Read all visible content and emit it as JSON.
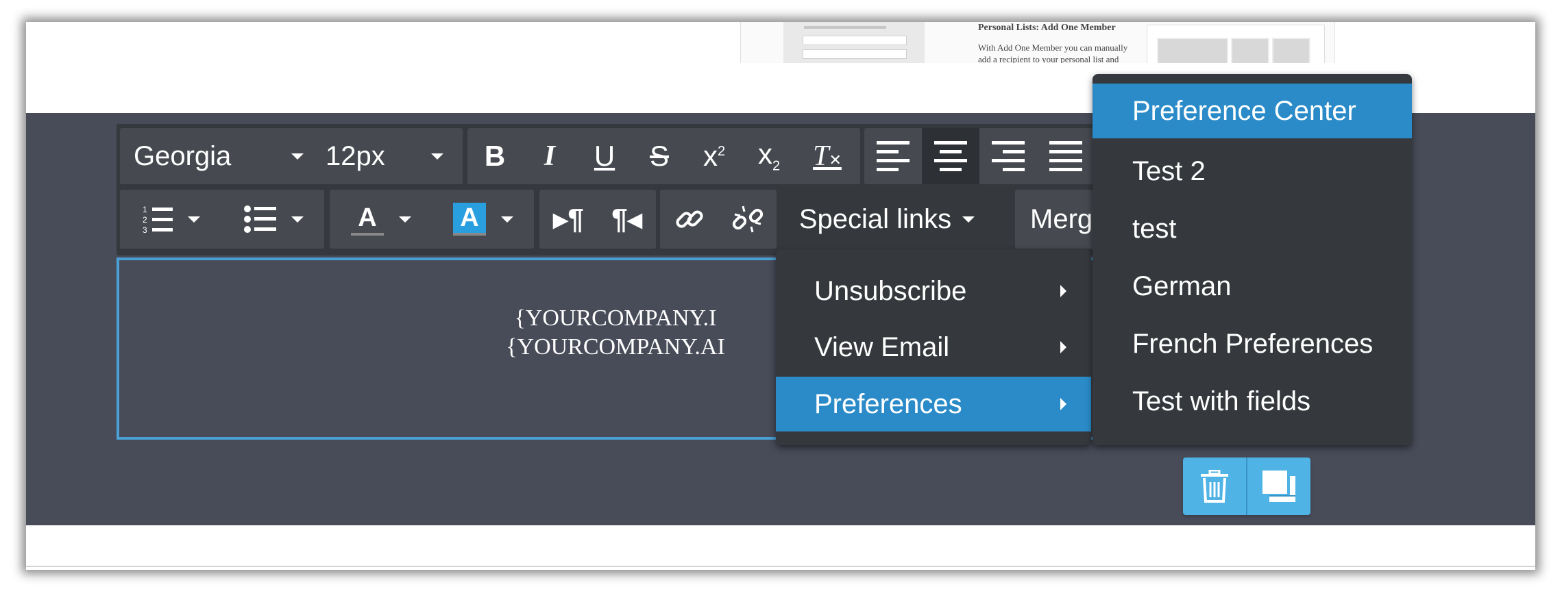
{
  "toolbar": {
    "font_family": "Georgia",
    "font_size": "12px",
    "special_links_label": "Special links",
    "merge_label": "Merge t"
  },
  "editor": {
    "line1": "{YOURCOMPANY.I",
    "line2": "{YOURCOMPANY.AI"
  },
  "special_links_menu": {
    "items": [
      {
        "label": "Unsubscribe"
      },
      {
        "label": "View Email"
      },
      {
        "label": "Preferences"
      }
    ],
    "active_index": 2
  },
  "preferences_menu": {
    "items": [
      {
        "label": "Preference Center"
      },
      {
        "label": "Test 2"
      },
      {
        "label": "test"
      },
      {
        "label": "German"
      },
      {
        "label": "French Preferences"
      },
      {
        "label": "Test with fields"
      }
    ],
    "active_index": 0
  },
  "thumbnail": {
    "heading": "Personal Lists: Add One Member",
    "body": "With Add One Member you can manually add a recipient to your personal list and"
  },
  "colors": {
    "footer_bg": "#484b58",
    "toolbar_bg": "#35393d",
    "accent": "#2a8bc8",
    "editor_border": "#4aa0d5",
    "action_bg": "#4fb3e6"
  },
  "icons": {
    "delete": "trash-icon",
    "duplicate": "copy-icon"
  }
}
